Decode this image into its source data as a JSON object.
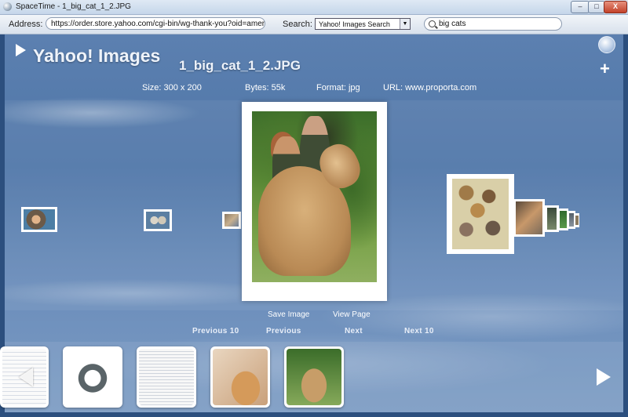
{
  "window": {
    "title": "SpaceTime - 1_big_cat_1_2.JPG",
    "minimize": "–",
    "maximize": "□",
    "close": "X"
  },
  "toolbar": {
    "address_label": "Address:",
    "address_value": "https://order.store.yahoo.com/cgi-bin/wg-thank-you?oid=american",
    "search_label": "Search:",
    "search_engine": "Yahoo! Images Search",
    "search_query": "big cats"
  },
  "header": {
    "brand": "Yahoo! Images",
    "image_title": "1_big_cat_1_2.JPG",
    "add": "+"
  },
  "meta": {
    "size": "Size: 300 x 200",
    "bytes": "Bytes: 55k",
    "format": "Format: jpg",
    "url": "URL: www.proporta.com"
  },
  "actions": {
    "save_image": "Save Image",
    "view_page": "View Page"
  },
  "pagination": {
    "previous_10": "Previous 10",
    "previous": "Previous",
    "next": "Next",
    "next_10": "Next 10"
  },
  "colors": {
    "stage": "#4f76a8",
    "text": "#ffffff"
  },
  "icons": {
    "play": "play-icon",
    "globe": "globe-icon",
    "prev": "left-arrow-icon",
    "next": "right-arrow-icon"
  }
}
